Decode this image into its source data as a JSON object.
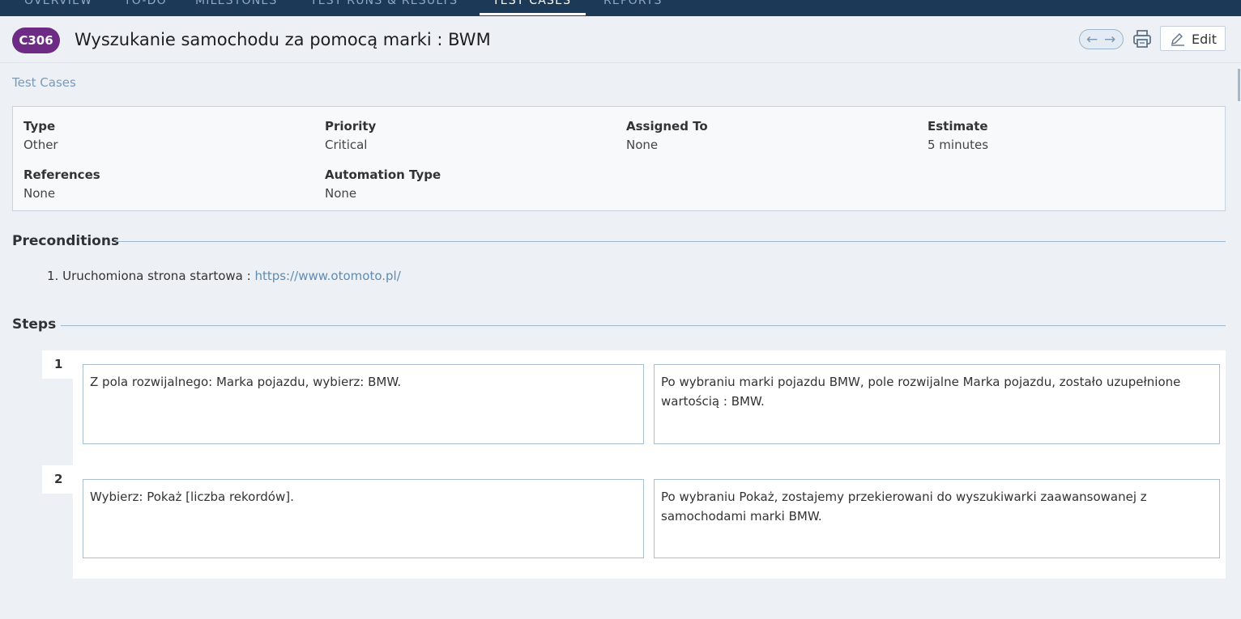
{
  "nav": {
    "tabs": [
      {
        "label": "OVERVIEW",
        "active": false
      },
      {
        "label": "TO-DO",
        "active": false
      },
      {
        "label": "MILESTONES",
        "active": false
      },
      {
        "label": "TEST RUNS & RESULTS",
        "active": false
      },
      {
        "label": "TEST CASES",
        "active": true
      },
      {
        "label": "REPORTS",
        "active": false
      }
    ]
  },
  "header": {
    "case_id": "C306",
    "title": "Wyszukanie samochodu za pomocą marki : BWM",
    "edit_label": "Edit",
    "icons": [
      "arrow-left-icon",
      "arrow-right-icon",
      "print-icon",
      "pencil-icon"
    ]
  },
  "breadcrumb": "Test Cases",
  "properties": {
    "type": {
      "label": "Type",
      "value": "Other"
    },
    "priority": {
      "label": "Priority",
      "value": "Critical"
    },
    "assigned_to": {
      "label": "Assigned To",
      "value": "None"
    },
    "estimate": {
      "label": "Estimate",
      "value": "5 minutes"
    },
    "references": {
      "label": "References",
      "value": "None"
    },
    "automation_type": {
      "label": "Automation Type",
      "value": "None"
    }
  },
  "preconditions": {
    "heading": "Preconditions",
    "item_number": "1.",
    "item_text": "Uruchomiona strona startowa : ",
    "item_link": "https://www.otomoto.pl/"
  },
  "steps": {
    "heading": "Steps",
    "items": [
      {
        "number": "1",
        "content": "Z pola rozwijalnego: Marka pojazdu, wybierz: BMW.",
        "expected": "Po wybraniu marki pojazdu BMW, pole rozwijalne Marka pojazdu, zostało uzupełnione wartością : BMW."
      },
      {
        "number": "2",
        "content": "Wybierz: Pokaż [liczba rekordów].",
        "expected": "Po wybraniu Pokaż, zostajemy przekierowani do wyszukiwarki zaawansowanej z samochodami marki BMW."
      }
    ]
  },
  "colors": {
    "nav_bg": "#1c3a57",
    "badge": "#6d2b86",
    "link": "#5f8cb3",
    "page_bg": "#edf0f5"
  }
}
